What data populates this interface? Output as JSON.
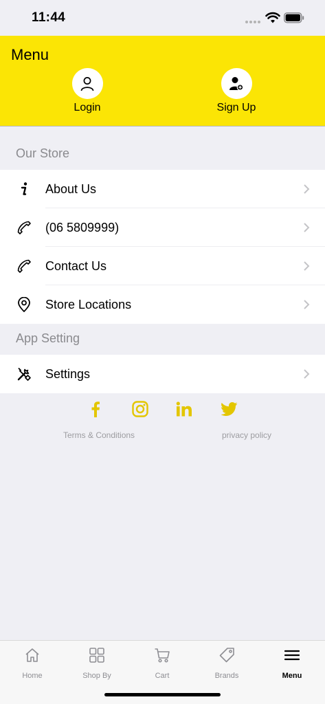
{
  "status_bar": {
    "time": "11:44"
  },
  "header": {
    "title": "Menu",
    "login_label": "Login",
    "signup_label": "Sign Up",
    "background": "#fbe505"
  },
  "sections": [
    {
      "title": "Our Store",
      "items": [
        {
          "label": "About Us",
          "icon": "info-icon"
        },
        {
          "label": "(06 5809999)",
          "icon": "phone-icon"
        },
        {
          "label": "Contact Us",
          "icon": "phone-icon"
        },
        {
          "label": "Store Locations",
          "icon": "location-pin-icon"
        }
      ]
    },
    {
      "title": "App Setting",
      "items": [
        {
          "label": "Settings",
          "icon": "tools-icon"
        }
      ]
    }
  ],
  "social": {
    "accent": "#e3c600",
    "icons": [
      "facebook-icon",
      "instagram-icon",
      "linkedin-icon",
      "twitter-icon"
    ]
  },
  "links": {
    "terms": "Terms & Conditions",
    "privacy": "privacy policy"
  },
  "tabs": [
    {
      "label": "Home",
      "icon": "home-icon",
      "active": false
    },
    {
      "label": "Shop By",
      "icon": "grid-icon",
      "active": false
    },
    {
      "label": "Cart",
      "icon": "cart-icon",
      "active": false
    },
    {
      "label": "Brands",
      "icon": "tag-icon",
      "active": false
    },
    {
      "label": "Menu",
      "icon": "menu-icon",
      "active": true
    }
  ]
}
